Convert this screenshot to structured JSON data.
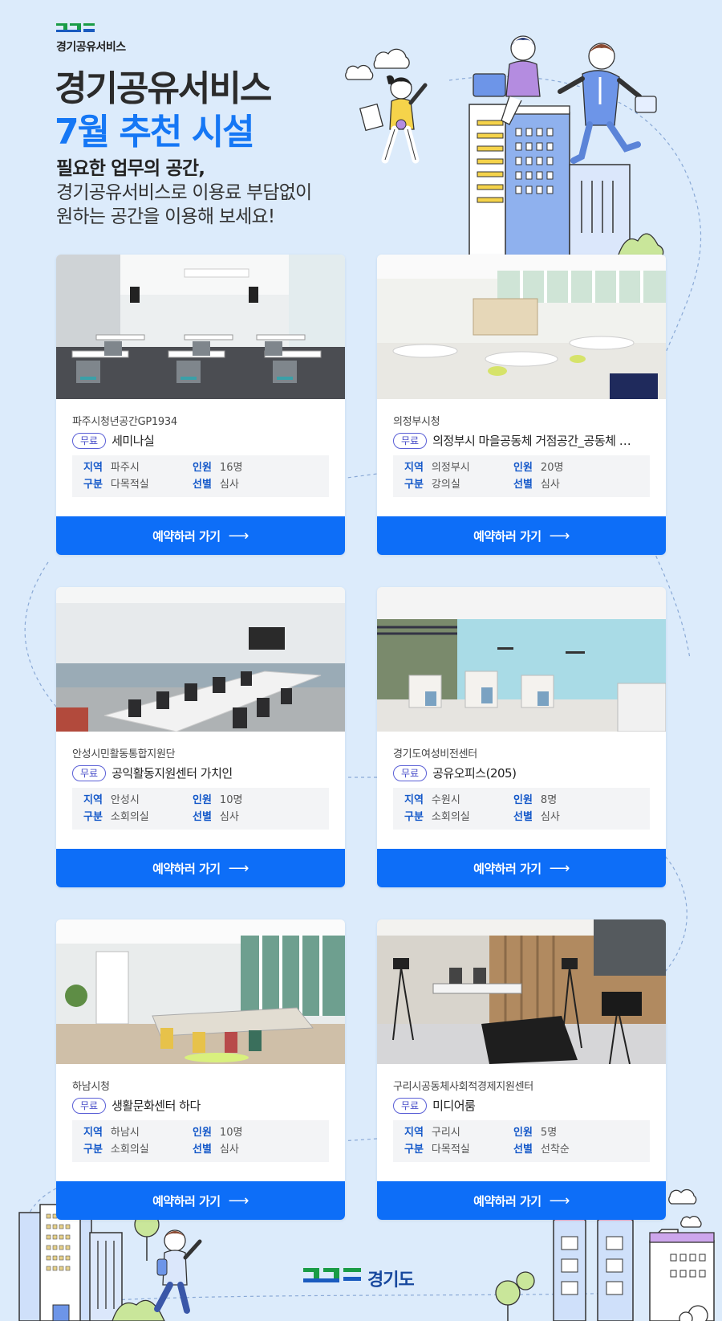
{
  "brand": {
    "logo_name": "경기공유서비스",
    "logo_mark_colors": [
      "#1a9c46",
      "#1a5bbf"
    ],
    "title_line1": "경기공유서비스",
    "title_line2": "7월 추천 시설",
    "title_accent_color": "#1577f5"
  },
  "intro": {
    "line1": "필요한 업무의 공간,",
    "line2": "경기공유서비스로 이용료 부담없이",
    "line3": "원하는 공간을 이용해 보세요!"
  },
  "labels": {
    "region": "지역",
    "capacity": "인원",
    "category": "구분",
    "selection": "선별"
  },
  "facilities": [
    {
      "org": "파주시청년공간GP1934",
      "badge": "무료",
      "name": "세미나실",
      "region": "파주시",
      "capacity": "16명",
      "category": "다목적실",
      "selection": "심사",
      "cta": "예약하러 가기",
      "photo_icon": "seminar-room-photo"
    },
    {
      "org": "의정부시청",
      "badge": "무료",
      "name": "의정부시 마을공동체 거점공간_공동체 …",
      "region": "의정부시",
      "capacity": "20명",
      "category": "강의실",
      "selection": "심사",
      "cta": "예약하러 가기",
      "photo_icon": "lecture-room-photo"
    },
    {
      "org": "안성시민활동통합지원단",
      "badge": "무료",
      "name": "공익활동지원센터 가치인",
      "region": "안성시",
      "capacity": "10명",
      "category": "소회의실",
      "selection": "심사",
      "cta": "예약하러 가기",
      "photo_icon": "meeting-room-photo"
    },
    {
      "org": "경기도여성비전센터",
      "badge": "무료",
      "name": "공유오피스(205)",
      "region": "수원시",
      "capacity": "8명",
      "category": "소회의실",
      "selection": "심사",
      "cta": "예약하러 가기",
      "photo_icon": "shared-office-photo"
    },
    {
      "org": "하남시청",
      "badge": "무료",
      "name": "생활문화센터 하다",
      "region": "하남시",
      "capacity": "10명",
      "category": "소회의실",
      "selection": "심사",
      "cta": "예약하러 가기",
      "photo_icon": "culture-room-photo"
    },
    {
      "org": "구리시공동체사회적경제지원센터",
      "badge": "무료",
      "name": "미디어룸",
      "region": "구리시",
      "capacity": "5명",
      "category": "다목적실",
      "selection": "선착순",
      "cta": "예약하러 가기",
      "photo_icon": "media-room-photo"
    }
  ],
  "footer": {
    "logo_text": "경기도"
  },
  "colors": {
    "background": "#dcebfb",
    "cta": "#0d6ef8",
    "label_blue": "#1458c9",
    "badge": "#5a5fd6"
  }
}
